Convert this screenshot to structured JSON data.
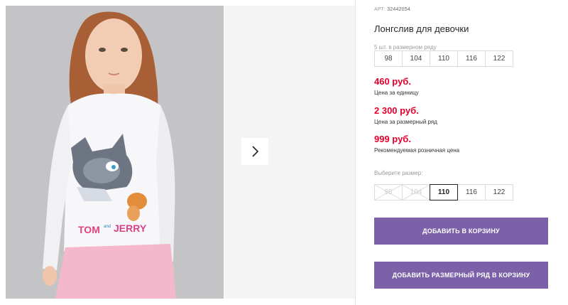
{
  "product": {
    "article_label": "АРТ:",
    "article_number": "32442054",
    "title": "Лонгслив для девочки",
    "set_label": "5 шт. в размерном ряду",
    "set_sizes": [
      "98",
      "104",
      "110",
      "116",
      "122"
    ]
  },
  "prices": {
    "unit_price": "460 руб.",
    "unit_price_note": "Цена за единицу",
    "set_price": "2 300 руб.",
    "set_price_note": "Цена за размерный ряд",
    "retail_price": "999 руб.",
    "retail_price_note": "Рекомендуемая розничная цена"
  },
  "size_picker": {
    "label": "Выберите размер:",
    "options": [
      "98",
      "104",
      "110",
      "116",
      "122"
    ],
    "disabled": [
      "98",
      "104"
    ],
    "selected": "110"
  },
  "actions": {
    "add_to_cart": "ДОБАВИТЬ В КОРЗИНУ",
    "add_set_to_cart": "ДОБАВИТЬ РАЗМЕРНЫЙ РЯД В КОРЗИНУ"
  },
  "gallery": {
    "print_text_left": "TOM",
    "print_text_mid": "and",
    "print_text_right": "JERRY",
    "next_icon": "chevron-right-icon"
  },
  "colors": {
    "price": "#e4002b",
    "button": "#7b61a8",
    "text": "#222222"
  }
}
